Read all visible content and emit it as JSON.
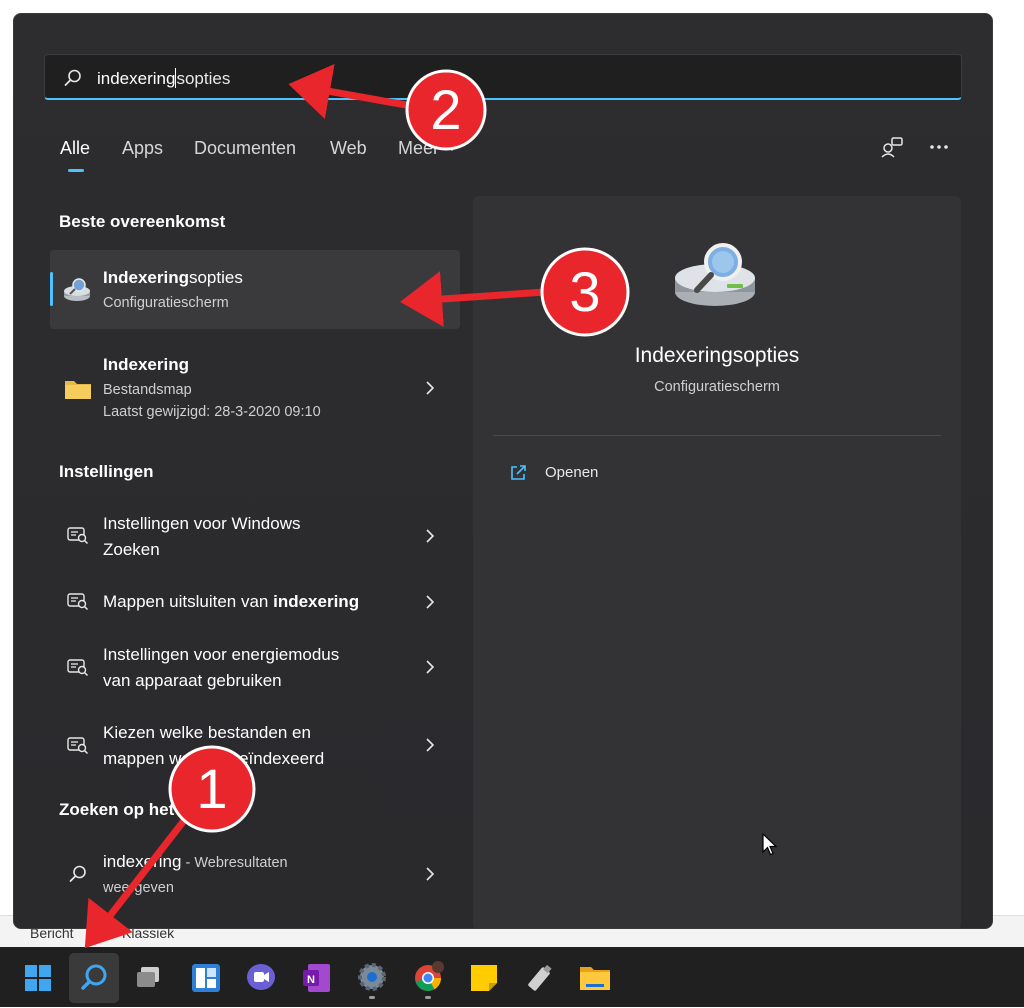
{
  "background_app": {
    "left_text": "Bericht",
    "right_text": "Klassiek"
  },
  "search": {
    "typed": "indexering",
    "completion": "sopties",
    "value": "indexeringsopties"
  },
  "tabs": [
    {
      "label": "Alle",
      "active": true
    },
    {
      "label": "Apps",
      "active": false
    },
    {
      "label": "Documenten",
      "active": false
    },
    {
      "label": "Web",
      "active": false
    },
    {
      "label": "Meer",
      "active": false
    }
  ],
  "sections": {
    "best_match": "Beste overeenkomst",
    "settings": "Instellingen",
    "web": "Zoeken op het"
  },
  "best_match_item": {
    "title_bold": "Indexering",
    "title_rest": "sopties",
    "subtitle": "Configuratiescherm"
  },
  "folder_item": {
    "title": "Indexering",
    "subtitle": "Bestandsmap",
    "modified": "Laatst gewijzigd: 28-3-2020 09:10"
  },
  "settings_items": [
    {
      "line1": "Instellingen voor Windows",
      "line2": "Zoeken"
    },
    {
      "line1_pre": "Mappen uitsluiten van ",
      "line1_bold": "indexering"
    },
    {
      "line1": "Instellingen voor energiemodus",
      "line2": "van apparaat gebruiken"
    },
    {
      "line1": "Kiezen welke bestanden en",
      "line2": "mappen worden geïndexeerd"
    }
  ],
  "web_item": {
    "title": "indexering",
    "suffix": " - Webresultaten",
    "line2": "weergeven"
  },
  "preview": {
    "title": "Indexeringsopties",
    "subtitle": "Configuratiescherm",
    "action_label": "Openen"
  },
  "annotations": {
    "one": "1",
    "two": "2",
    "three": "3"
  },
  "colors": {
    "accent": "#4cc2ff",
    "annotation_red": "#e8262b",
    "panel_bg": "#2b2b2b",
    "taskbar_bg": "#202020"
  },
  "taskbar_icons": [
    "windows-start-icon",
    "search-icon",
    "task-view-icon",
    "widgets-icon",
    "teams-chat-icon",
    "onenote-icon",
    "settings-icon",
    "chrome-icon",
    "sticky-notes-icon",
    "usb-drive-icon",
    "file-explorer-icon"
  ]
}
